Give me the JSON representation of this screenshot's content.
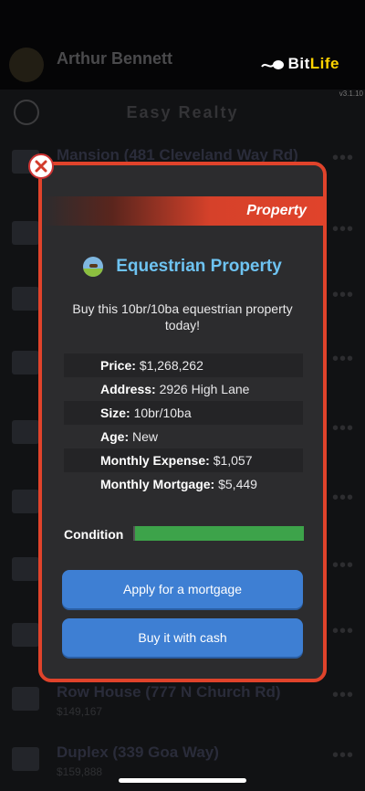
{
  "app": {
    "logo_prefix": "Bit",
    "logo_suffix": "Life",
    "version": "v3.1.10",
    "player_name": "Arthur Bennett",
    "screen_title": "Easy Realty"
  },
  "background_listings": [
    {
      "name": "Mansion (481 Cleveland Way Rd)",
      "price": ""
    },
    {
      "name": "",
      "price": ""
    },
    {
      "name": "",
      "price": ""
    },
    {
      "name": "",
      "price": ""
    },
    {
      "name": "",
      "price": ""
    },
    {
      "name": "",
      "price": ""
    },
    {
      "name": "",
      "price": ""
    },
    {
      "name": "",
      "price": ""
    },
    {
      "name": "Row House (777 N Church Rd)",
      "price": "$149,167"
    },
    {
      "name": "Duplex (339 Goa Way)",
      "price": "$159,888"
    }
  ],
  "modal": {
    "category": "Property",
    "title": "Equestrian Property",
    "description": "Buy this 10br/10ba equestrian property today!",
    "details": [
      {
        "label": "Price:",
        "value": "$1,268,262"
      },
      {
        "label": "Address:",
        "value": "2926 High Lane"
      },
      {
        "label": "Size:",
        "value": "10br/10ba"
      },
      {
        "label": "Age:",
        "value": "New"
      },
      {
        "label": "Monthly Expense:",
        "value": "$1,057"
      },
      {
        "label": "Monthly Mortgage:",
        "value": "$5,449"
      }
    ],
    "condition_label": "Condition",
    "condition_percent": 100,
    "buttons": {
      "mortgage": "Apply for a mortgage",
      "cash": "Buy it with cash"
    }
  },
  "colors": {
    "accent_red": "#e0432b",
    "title_blue": "#6ec3f1",
    "button_blue": "#3e7fd3",
    "condition_green": "#3da34a"
  }
}
